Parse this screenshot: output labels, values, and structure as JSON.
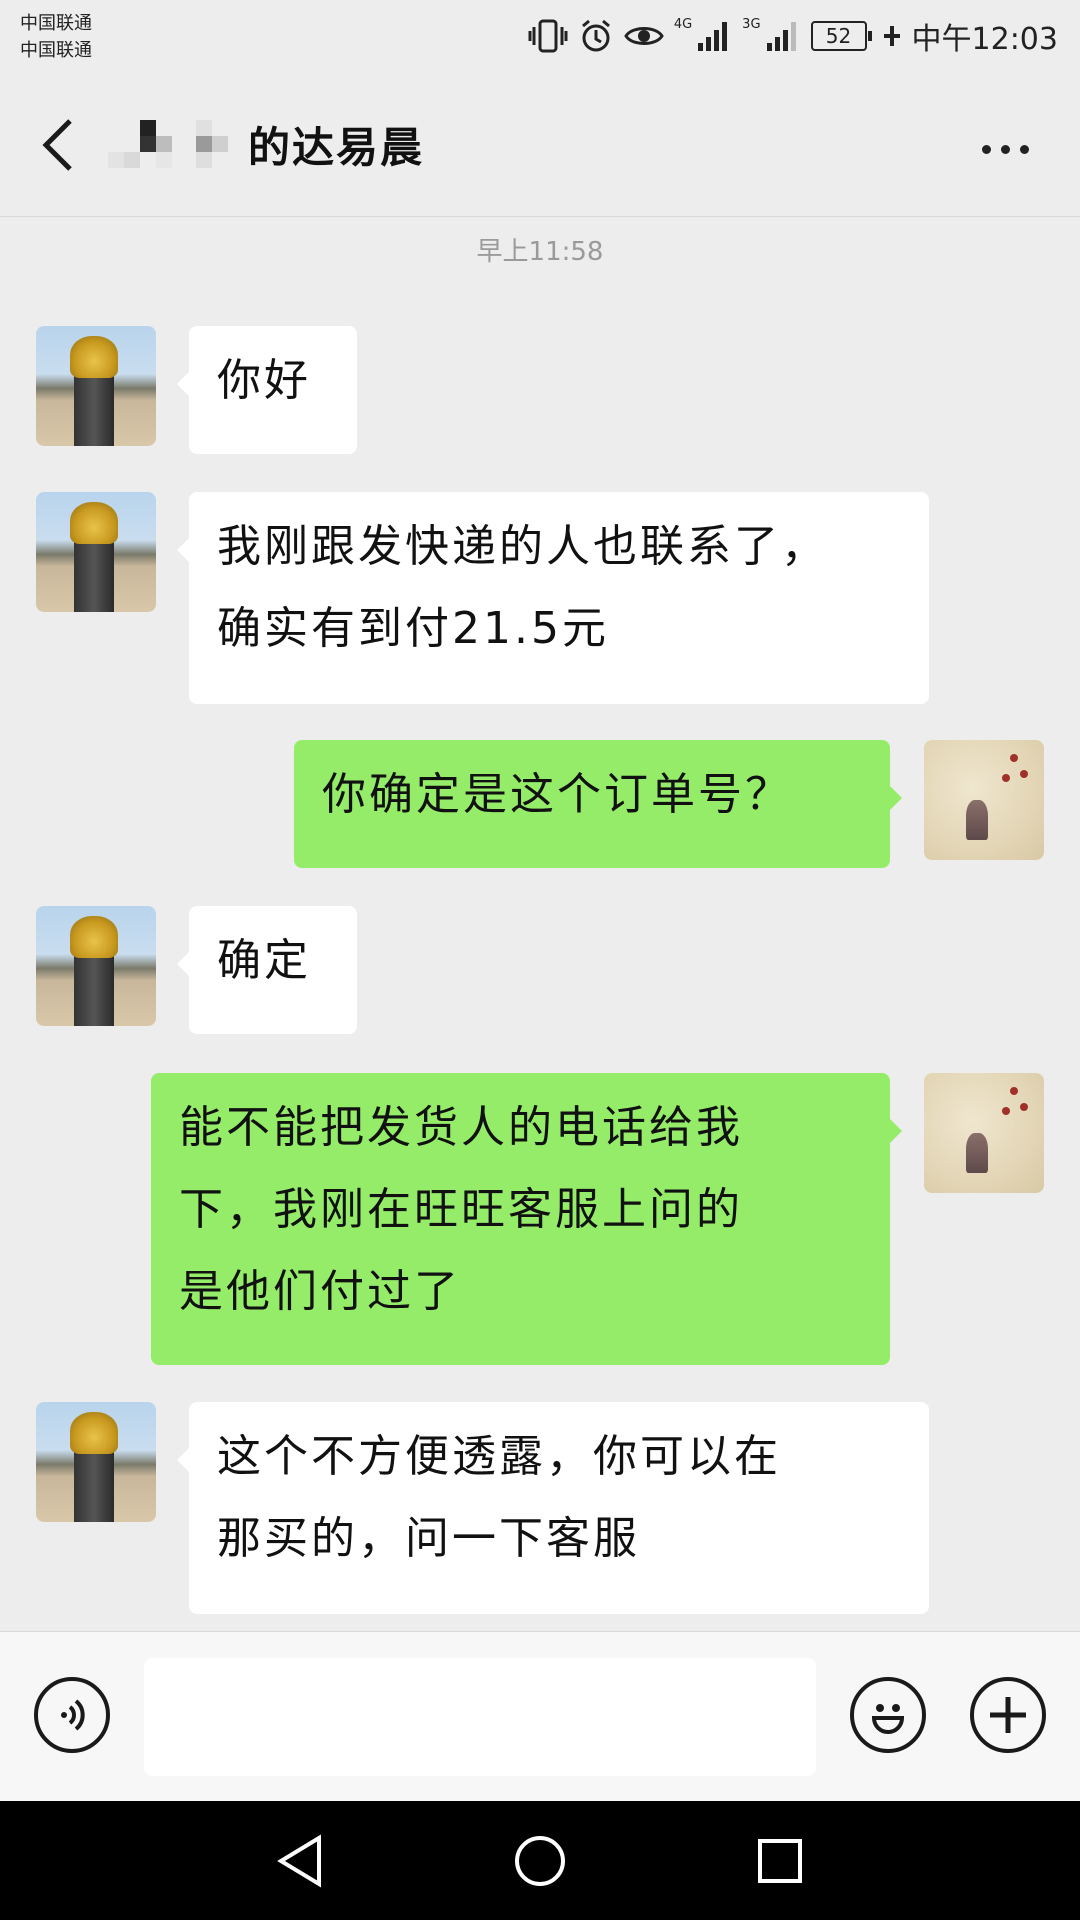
{
  "status_bar": {
    "carrier_1": "中国联通",
    "carrier_2": "中国联通",
    "net_1": "4G",
    "net_2": "3G",
    "battery": "52",
    "time": "中午12:03"
  },
  "header": {
    "title": "的达易晨",
    "icons": {
      "back": "chevron-left-icon",
      "more": "more-dots-icon"
    }
  },
  "chat": {
    "timestamp": "早上11:58",
    "messages": [
      {
        "side": "left",
        "lines": [
          "你好"
        ]
      },
      {
        "side": "left",
        "lines": [
          "我刚跟发快递的人也联系了，",
          "确实有到付21.5元"
        ]
      },
      {
        "side": "right",
        "lines": [
          "你确定是这个订单号？"
        ]
      },
      {
        "side": "left",
        "lines": [
          "确定"
        ]
      },
      {
        "side": "right",
        "lines": [
          "能不能把发货人的电话给我",
          "下，我刚在旺旺客服上问的",
          "是他们付过了"
        ]
      },
      {
        "side": "left",
        "lines": [
          "这个不方便透露，你可以在",
          "那买的，问一下客服"
        ]
      }
    ]
  },
  "input_bar": {
    "value": "",
    "icons": {
      "voice": "voice-icon",
      "emoji": "emoji-icon",
      "add": "plus-icon"
    }
  },
  "nav_bar": {
    "icons": {
      "back": "nav-back-icon",
      "home": "nav-home-icon",
      "recents": "nav-recents-icon"
    }
  },
  "colors": {
    "background": "#ededed",
    "my_bubble": "#95ec69",
    "their_bubble": "#ffffff"
  }
}
